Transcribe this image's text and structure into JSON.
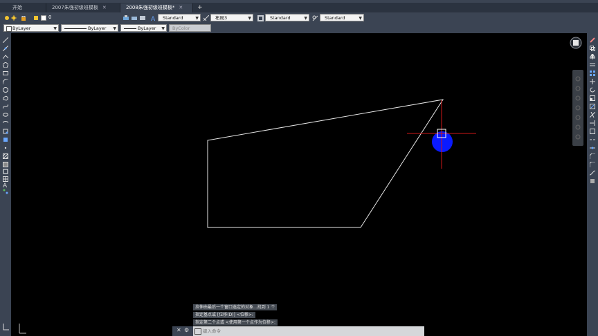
{
  "tabs": [
    {
      "label": "开始",
      "active": false
    },
    {
      "label": "2007朱强初级班模板",
      "active": false
    },
    {
      "label": "2008朱强初级班模板*",
      "active": true
    }
  ],
  "tab_close": "✕",
  "tab_add": "+",
  "toolbar1": {
    "layer_value": "0",
    "text_style": "Standard",
    "layout": "布局3",
    "dim_style": "Standard",
    "table_style": "Standard"
  },
  "toolbar2": {
    "color": "ByLayer",
    "linetype": "ByLayer",
    "lineweight": "ByLayer",
    "plotstyle": "ByColor"
  },
  "command_history": [
    "拉伸由最后一个窗口选定的对象...找到 1 个",
    "指定基点或 [位移(D)] <位移>:",
    "指定第二个点或 <使用第一个点作为位移>:"
  ],
  "command_input": {
    "placeholder": "键入命令"
  },
  "colors": {
    "accent": "#0a1aff",
    "crosshair": "#d01818",
    "linework": "#e6e6e6",
    "panel": "#3b4453"
  }
}
